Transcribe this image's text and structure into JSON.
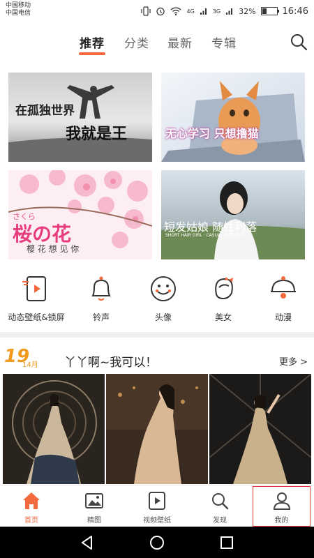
{
  "statusbar": {
    "carrier1": "中国移动",
    "carrier2": "中国电信",
    "signal1": "4G",
    "signal2": "3G",
    "battery": "32%",
    "battery_level": 0.32,
    "time": "16:46"
  },
  "tabs": [
    {
      "label": "推荐",
      "active": true
    },
    {
      "label": "分类",
      "active": false
    },
    {
      "label": "最新",
      "active": false
    },
    {
      "label": "专辑",
      "active": false
    }
  ],
  "banners": [
    {
      "line1": "在孤独世界",
      "line2": "我就是王"
    },
    {
      "text": "无心学习 只想撸猫"
    },
    {
      "kana": "さくら",
      "title": "桜の花",
      "subtitle": "樱 花 想 见 你"
    },
    {
      "text": "短发姑娘  随性利落",
      "small": "SHORT HAIR GIRL · CASUAL INTEREST"
    }
  ],
  "categories": [
    {
      "label": "动态壁纸&锁屏",
      "icon": "video-wallpaper-icon"
    },
    {
      "label": "铃声",
      "icon": "bell-icon"
    },
    {
      "label": "头像",
      "icon": "smiley-face-icon"
    },
    {
      "label": "美女",
      "icon": "girl-head-icon"
    },
    {
      "label": "动漫",
      "icon": "anime-bell-icon"
    }
  ],
  "featured": {
    "day": "19",
    "month": "14月",
    "title": "丫丫啊~我可以！",
    "more": "更多 >"
  },
  "bottom_nav": [
    {
      "label": "首页",
      "icon": "home-icon",
      "active": true
    },
    {
      "label": "精图",
      "icon": "image-icon",
      "active": false
    },
    {
      "label": "视频壁纸",
      "icon": "video-play-icon",
      "active": false
    },
    {
      "label": "发现",
      "icon": "search-icon",
      "active": false
    },
    {
      "label": "我的",
      "icon": "user-icon",
      "active": false
    }
  ],
  "colors": {
    "accent": "#f26a3d",
    "date": "#f29a1e"
  }
}
